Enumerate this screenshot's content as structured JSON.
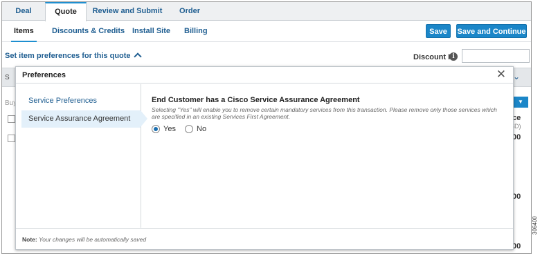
{
  "tabs": [
    {
      "label": "Deal"
    },
    {
      "label": "Quote"
    },
    {
      "label": "Review and Submit"
    },
    {
      "label": "Order"
    }
  ],
  "subnav": {
    "items": [
      {
        "label": "Items"
      },
      {
        "label": "Discounts & Credits"
      },
      {
        "label": "Install Site"
      },
      {
        "label": "Billing"
      }
    ],
    "save_label": "Save",
    "save_continue_label": "Save and Continue ›"
  },
  "page": {
    "prefs_link": "Set item preferences for this quote",
    "prefs_link_icon": "chevron-up-icon",
    "discount_label": "Discount ID",
    "discount_info_icon": "info-icon",
    "bar_text": "S",
    "buy_text": "Buy",
    "col_header": "ice",
    "col_subheader": "SD)",
    "amount_1": ".00",
    "amount_2": ".00",
    "amount_3": ".00"
  },
  "modal": {
    "title": "Preferences",
    "close_icon": "close-icon",
    "side_items": [
      {
        "label": "Service Preferences"
      },
      {
        "label": "Service Assurance Agreement"
      }
    ],
    "content_title": "End Customer has a Cisco Service Assurance Agreement",
    "content_desc": "Selecting \"Yes\" will enable you to remove certain mandatory services from this transaction. Please remove only those services which are specified in an existing Services First Agreement.",
    "radio_yes": "Yes",
    "radio_no": "No",
    "selected": "Yes",
    "note_prefix": "Note:",
    "note_text": "Your changes will be automatically saved"
  },
  "figure_number": "306400",
  "colors": {
    "accent": "#1b86c8",
    "link": "#1f5e91",
    "active_bg": "#e3f0fa"
  }
}
